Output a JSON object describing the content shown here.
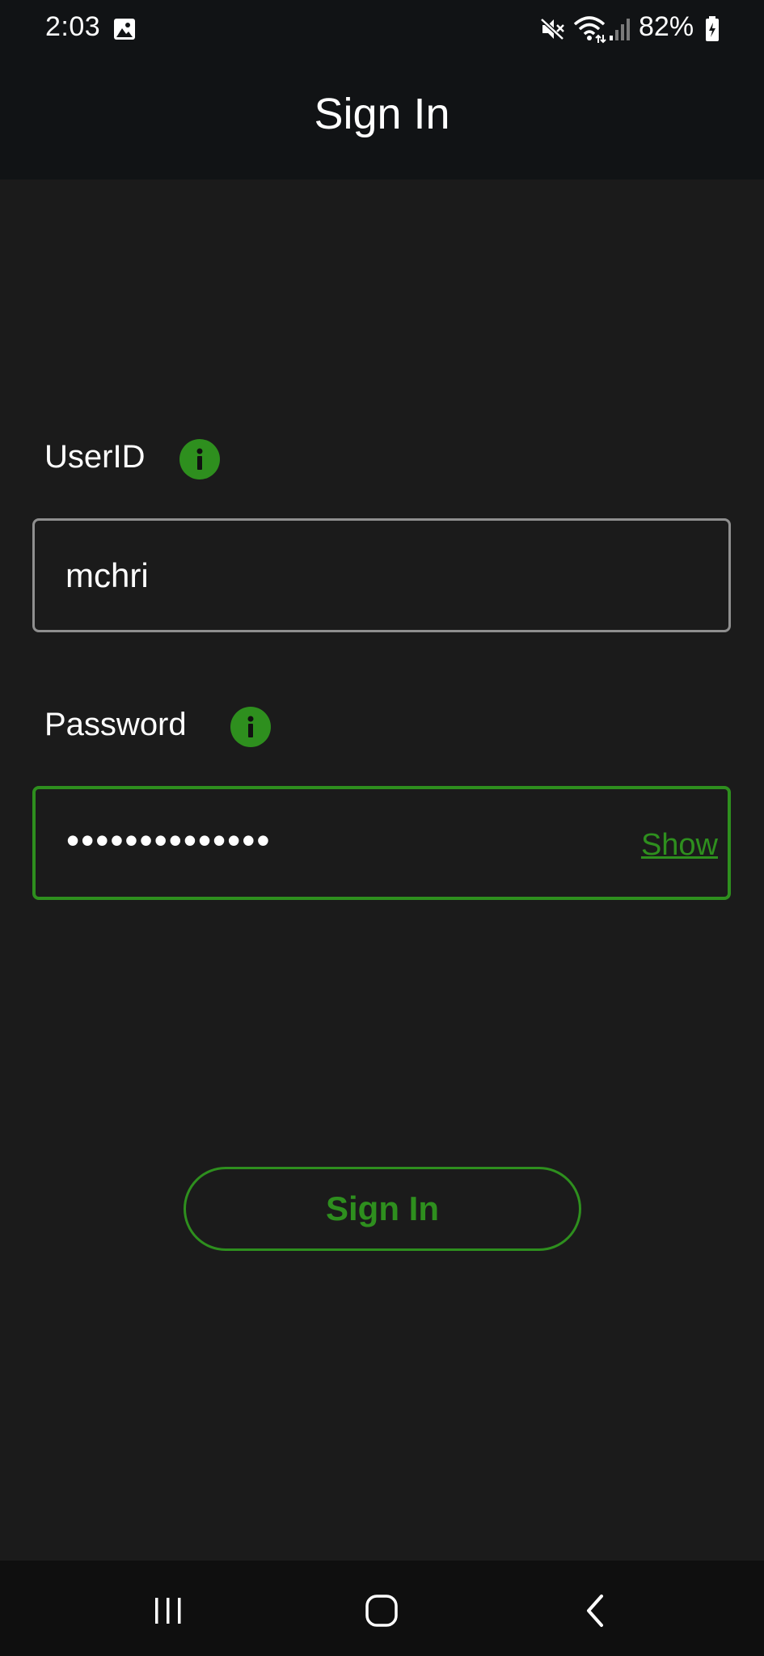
{
  "status_bar": {
    "time": "2:03",
    "battery": "82%",
    "icons": [
      "gallery-icon",
      "mute-icon",
      "wifi-icon",
      "signal-icon",
      "battery-icon"
    ]
  },
  "header": {
    "title": "Sign In"
  },
  "form": {
    "userid": {
      "label": "UserID",
      "value": "mchri",
      "info_icon": "info-icon"
    },
    "password": {
      "label": "Password",
      "value": "••••••••••••••",
      "show_label": "Show",
      "info_icon": "info-icon"
    },
    "submit_label": "Sign In"
  },
  "nav_bar": {
    "icons": [
      "recents-icon",
      "home-icon",
      "back-icon"
    ]
  },
  "colors": {
    "accent": "#2e8f1e",
    "background": "#1b1b1b",
    "bar_background": "#111315",
    "input_border": "#8f8f8f"
  }
}
